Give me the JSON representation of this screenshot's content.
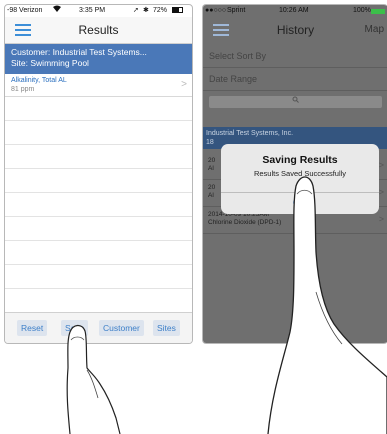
{
  "left_phone": {
    "status": {
      "carrier": "-98 Verizon",
      "wifi": "wifi-icon",
      "time": "3:35 PM",
      "right": "72%"
    },
    "nav": {
      "title": "Results",
      "menu_icon": "hamburger-icon"
    },
    "customer_header": {
      "customer": "Customer: Industrial Test Systems...",
      "site": "Site: Swimming Pool"
    },
    "results": [
      {
        "name": "Alkalinity, Total AL",
        "value": "81 ppm",
        "chevron": ">"
      }
    ],
    "toolbar": {
      "reset": "Reset",
      "save": "Save",
      "customer": "Customer",
      "sites": "Sites"
    }
  },
  "right_phone": {
    "status": {
      "carrier": "Sprint",
      "time": "10:26 AM",
      "battery": "100%"
    },
    "nav": {
      "title": "History",
      "map": "Map",
      "menu_icon": "hamburger-icon"
    },
    "select_sort": "Select  Sort By",
    "date_range": "Date Range",
    "search_icon": "search-icon",
    "section_header": {
      "company": "Industrial Test Systems, Inc.",
      "sub": "18"
    },
    "history_rows": [
      {
        "line1": "20",
        "line2": "Al"
      },
      {
        "line1": "20",
        "line2": "Al"
      },
      {
        "line1": "2014-10-09 10:25AM",
        "line2": "Chlorine Dioxide (DPD-1)",
        "line2_end": "m"
      }
    ],
    "alert": {
      "title": "Saving Results",
      "message": "Results Saved Successfully",
      "ok": "OK"
    }
  }
}
